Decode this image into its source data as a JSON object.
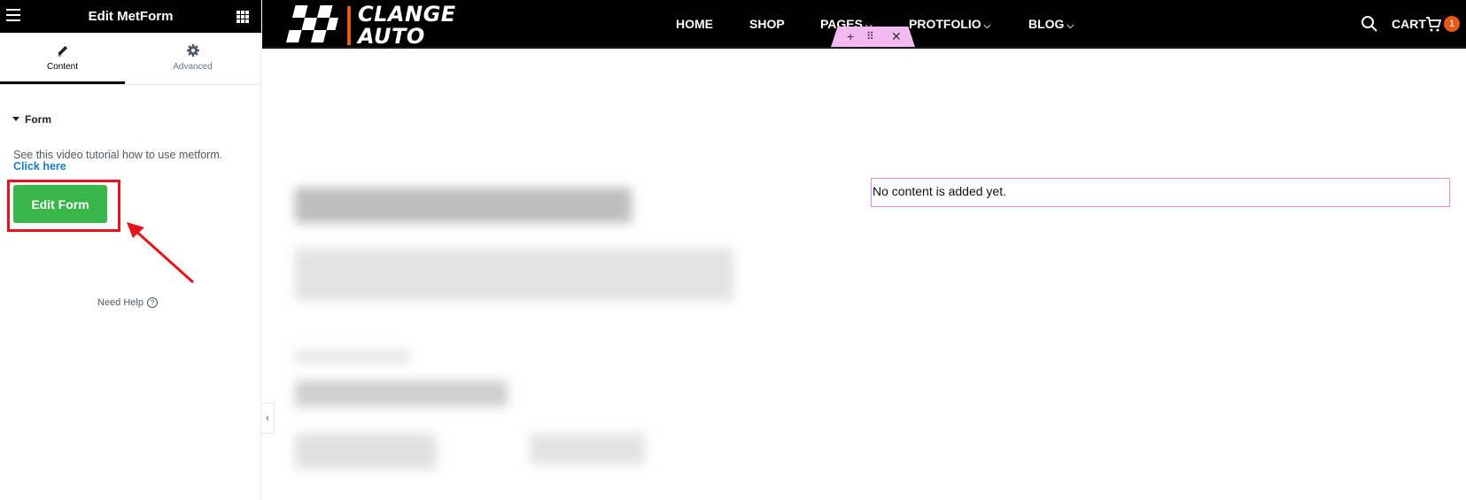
{
  "panel": {
    "title": "Edit MetForm",
    "tabs": [
      {
        "label": "Content",
        "icon": "pencil-icon"
      },
      {
        "label": "Advanced",
        "icon": "gear-icon"
      }
    ],
    "section_title": "Form",
    "description": "See this video tutorial how to use metform.",
    "link_text": "Click here",
    "edit_button": "Edit Form",
    "need_help": "Need Help"
  },
  "site": {
    "logo_line1": "CLANGE",
    "logo_line2": "AUTO",
    "nav": [
      "HOME",
      "SHOP",
      "PAGES",
      "PROTFOLIO",
      "BLOG"
    ],
    "cart_label": "CART",
    "cart_count": "1",
    "empty_widget_text": "No content is added yet."
  },
  "colors": {
    "accent_orange": "#e8591a",
    "button_green": "#39b54a",
    "highlight_red": "#e3141a",
    "toolbar_pink": "#f4b9f1"
  }
}
